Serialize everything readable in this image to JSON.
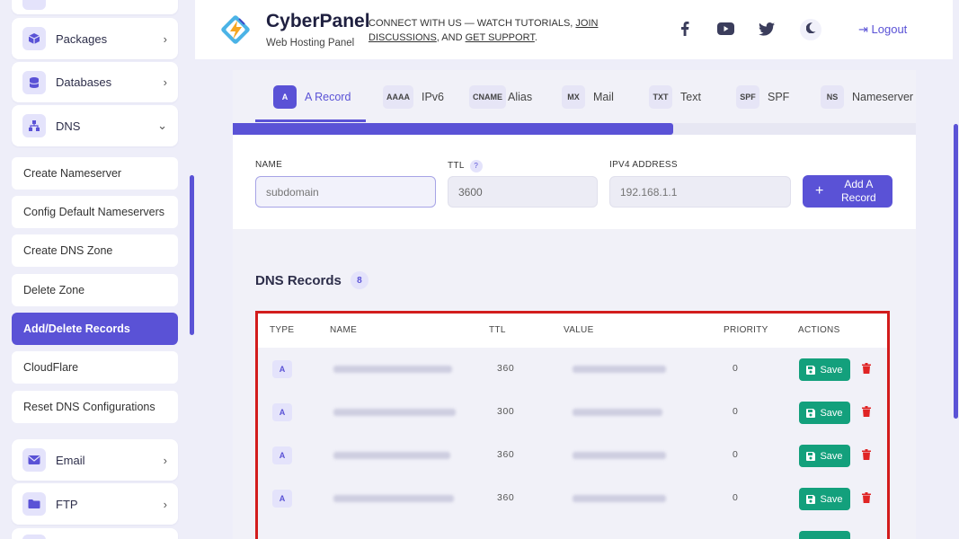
{
  "sidebar": {
    "items": [
      {
        "label": "Packages",
        "icon": "box-icon"
      },
      {
        "label": "Databases",
        "icon": "database-icon"
      },
      {
        "label": "DNS",
        "icon": "sitemap-icon"
      }
    ],
    "dns_sub": [
      "Create Nameserver",
      "Config Default Nameservers",
      "Create DNS Zone",
      "Delete Zone",
      "Add/Delete Records",
      "CloudFlare",
      "Reset DNS Configurations"
    ],
    "bottom_items": [
      {
        "label": "Email",
        "icon": "envelope-icon"
      },
      {
        "label": "FTP",
        "icon": "folder-icon"
      }
    ]
  },
  "header": {
    "brand": "CyberPanel",
    "brand_sub": "Web Hosting Panel",
    "tagline_prefix": "CONNECT WITH US — WATCH TUTORIALS, ",
    "tagline_link1": "JOIN DISCUSSIONS",
    "tagline_mid": ", AND ",
    "tagline_link2": "GET SUPPORT",
    "tagline_suffix": ".",
    "logout": "Logout",
    "accent": "#5a52d6"
  },
  "tabs": [
    {
      "badge": "A",
      "label": "A Record"
    },
    {
      "badge": "AAAA",
      "label": "IPv6"
    },
    {
      "badge": "CNAME",
      "label": "Alias"
    },
    {
      "badge": "MX",
      "label": "Mail"
    },
    {
      "badge": "TXT",
      "label": "Text"
    },
    {
      "badge": "SPF",
      "label": "SPF"
    },
    {
      "badge": "NS",
      "label": "Nameserver"
    }
  ],
  "form": {
    "name_label": "NAME",
    "name_placeholder": "subdomain",
    "ttl_label": "TTL",
    "ttl_help": "?",
    "ttl_value": "3600",
    "ip_label": "IPV4 ADDRESS",
    "ip_placeholder": "192.168.1.1",
    "add_button": "Add A Record",
    "add_plus": "+"
  },
  "records": {
    "title": "DNS Records",
    "count": "8",
    "columns": [
      "TYPE",
      "NAME",
      "TTL",
      "VALUE",
      "PRIORITY",
      "ACTIONS"
    ],
    "save_label": "Save",
    "rows": [
      {
        "type": "A",
        "ttl": "360",
        "priority": "0"
      },
      {
        "type": "A",
        "ttl": "300",
        "priority": "0"
      },
      {
        "type": "A",
        "ttl": "360",
        "priority": "0"
      },
      {
        "type": "A",
        "ttl": "360",
        "priority": "0"
      }
    ]
  }
}
